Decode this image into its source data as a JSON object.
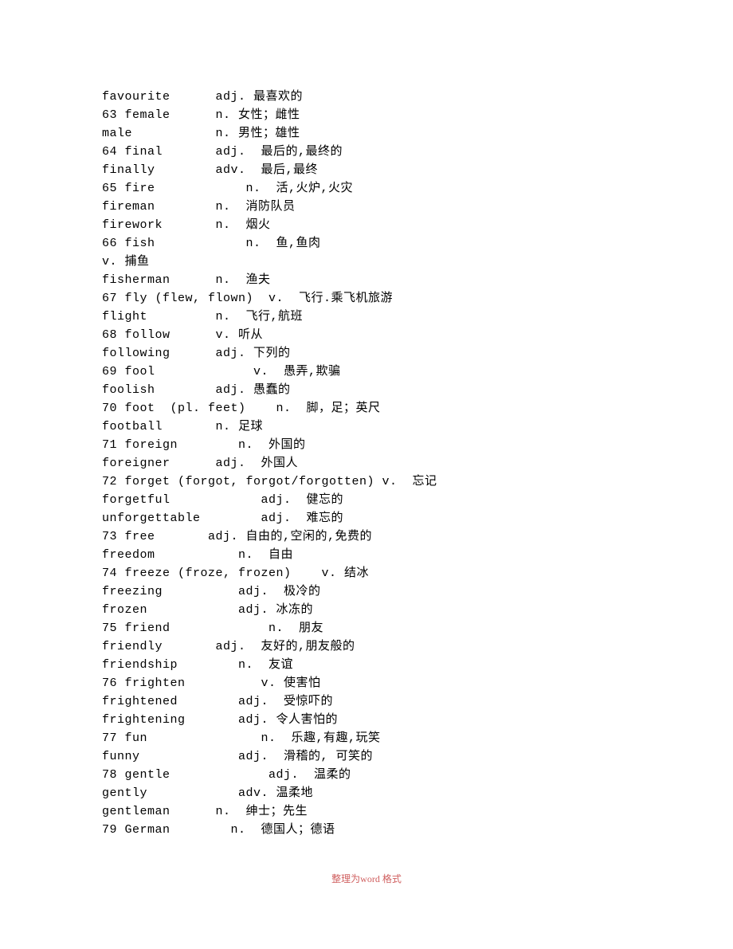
{
  "lines": [
    "favourite      adj. 最喜欢的",
    "63 female      n. 女性；雌性",
    "male           n. 男性；雄性",
    "64 final       adj.  最后的,最终的",
    "finally        adv.  最后,最终",
    "65 fire            n.  活,火炉,火灾",
    "fireman        n.  消防队员",
    "firework       n.  烟火",
    "66 fish            n.  鱼,鱼肉",
    "v. 捕鱼",
    "fisherman      n.  渔夫",
    "67 fly (flew, flown)  v.  飞行.乘飞机旅游",
    "flight         n.  飞行,航班",
    "68 follow      v. 听从",
    "following      adj. 下列的",
    "69 fool             v.  愚弄,欺骗",
    "foolish        adj. 愚蠢的",
    "70 foot  (pl. feet)    n.  脚，足；英尺",
    "football       n. 足球",
    "71 foreign        n.  外国的",
    "foreigner      adj.  外国人",
    "72 forget (forgot, forgot/forgotten) v.  忘记",
    "forgetful            adj.  健忘的",
    "unforgettable        adj.  难忘的",
    "73 free       adj. 自由的,空闲的,免费的",
    "freedom           n.  自由",
    "74 freeze (froze, frozen)    v. 结冰",
    "freezing          adj.  极冷的",
    "frozen            adj. 冰冻的",
    "75 friend             n.  朋友",
    "friendly       adj.  友好的,朋友般的",
    "friendship        n.  友谊",
    "76 frighten          v. 使害怕",
    "frightened        adj.  受惊吓的",
    "frightening       adj. 令人害怕的",
    "77 fun               n.  乐趣,有趣,玩笑",
    "funny             adj.  滑稽的, 可笑的",
    "78 gentle             adj.  温柔的",
    "gently            adv. 温柔地",
    "gentleman      n.  绅士；先生",
    "79 German        n.  德国人；德语"
  ],
  "footer": "整理为word 格式"
}
